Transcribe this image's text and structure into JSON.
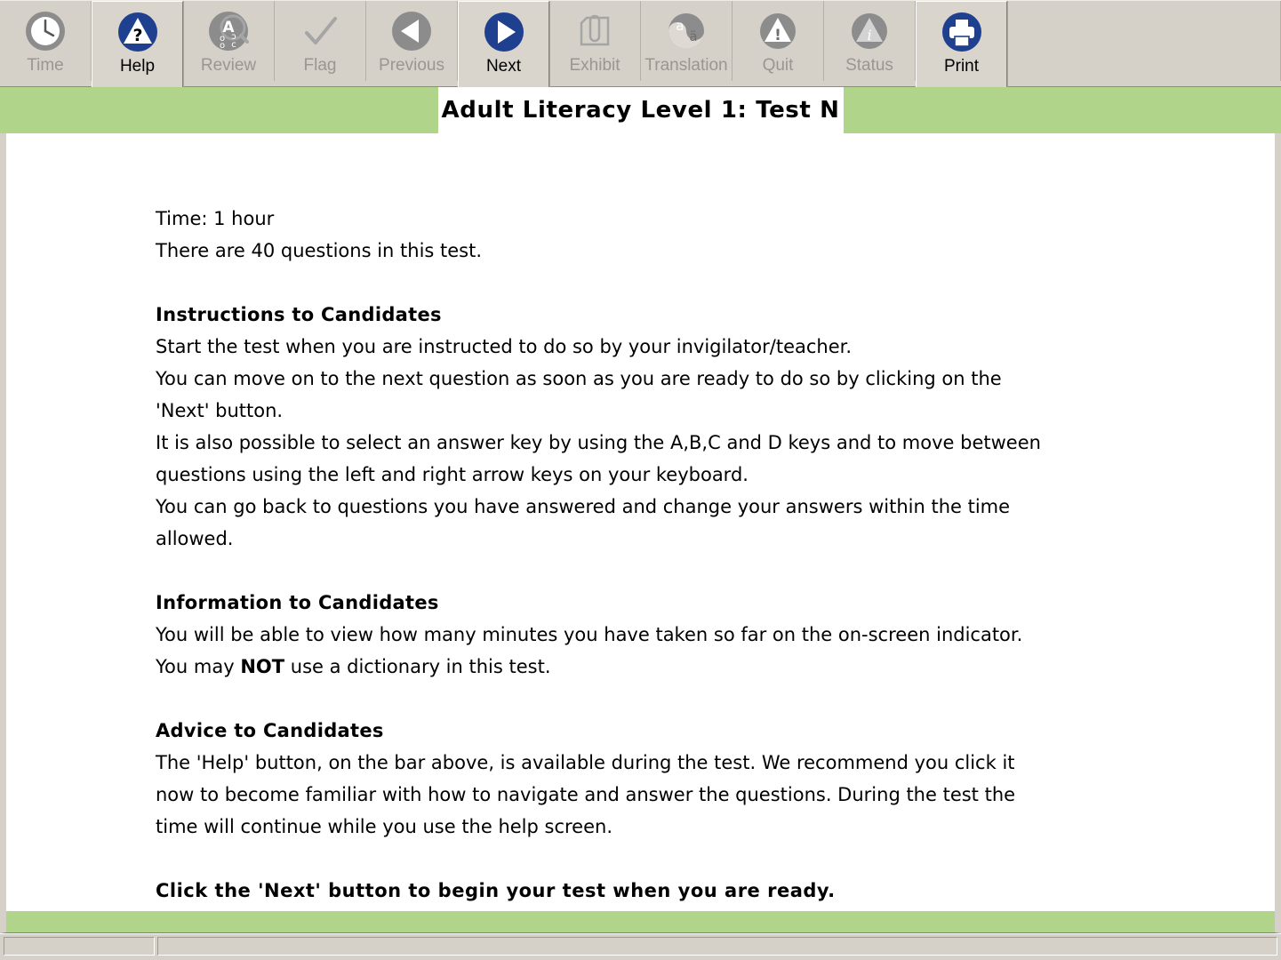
{
  "toolbar": {
    "buttons": [
      {
        "id": "time",
        "label": "Time",
        "icon": "clock-icon",
        "enabled": false
      },
      {
        "id": "help",
        "label": "Help",
        "icon": "help-triangle-icon",
        "enabled": true
      },
      {
        "id": "review",
        "label": "Review",
        "icon": "review-magnifier-icon",
        "enabled": false
      },
      {
        "id": "flag",
        "label": "Flag",
        "icon": "checkmark-icon",
        "enabled": false
      },
      {
        "id": "previous",
        "label": "Previous",
        "icon": "previous-arrow-icon",
        "enabled": false
      },
      {
        "id": "next",
        "label": "Next",
        "icon": "next-arrow-icon",
        "enabled": true
      },
      {
        "id": "exhibit",
        "label": "Exhibit",
        "icon": "exhibit-clipboard-icon",
        "enabled": false
      },
      {
        "id": "translation",
        "label": "Translation",
        "icon": "translation-yinyang-icon",
        "enabled": false
      },
      {
        "id": "quit",
        "label": "Quit",
        "icon": "quit-warning-icon",
        "enabled": false
      },
      {
        "id": "status",
        "label": "Status",
        "icon": "status-info-icon",
        "enabled": false
      },
      {
        "id": "print",
        "label": "Print",
        "icon": "printer-icon",
        "enabled": true
      }
    ]
  },
  "header": {
    "title": "Adult Literacy Level 1: Test N"
  },
  "document": {
    "time_line": "Time: 1 hour",
    "questions_line": "There are 40 questions in this test.",
    "instructions_heading": "Instructions to Candidates",
    "instructions_line_1": "Start the test when you are instructed to do so by your invigilator/teacher.",
    "instructions_line_2": "You can move on to the next question as soon as you are ready to do so by clicking on the 'Next' button.",
    "instructions_line_3": "It is also possible to select an answer key by using the A,B,C and D keys and to move between questions using the left and right arrow keys on your keyboard.",
    "instructions_line_4": "You can go back to questions you have answered and change your answers within the time allowed.",
    "information_heading": "Information to Candidates",
    "information_line_1": "You will be able to view how many minutes you have taken so far on the on-screen indicator.",
    "information_line_2_pre": "You may ",
    "information_line_2_bold": "NOT",
    "information_line_2_post": " use a dictionary in this test.",
    "advice_heading": "Advice to Candidates",
    "advice_line_1": "The 'Help' button, on the bar above, is available during the test. We recommend you click it now to become familiar with how to navigate and answer the questions. During the test the time will continue while you use the help screen.",
    "closing_line": "Click the 'Next' button to begin your test when you are ready."
  },
  "statusbar": {
    "left_text": "",
    "right_text": ""
  },
  "colors": {
    "green_band": "#b0d48a",
    "toolbar_face": "#d5d0c8",
    "accent_blue": "#1f3f8f",
    "disabled_gray": "#8c8c8c"
  }
}
